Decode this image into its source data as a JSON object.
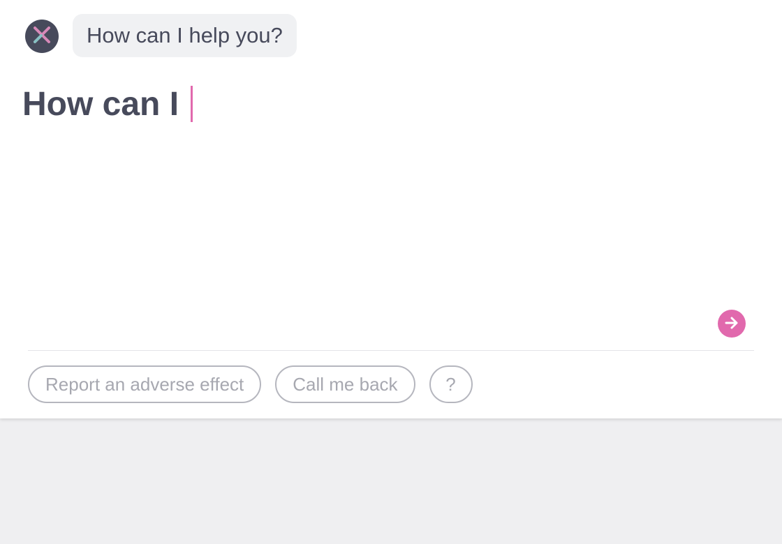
{
  "bot": {
    "avatar_icon": "logo-x-icon",
    "greeting": "How can I help you?"
  },
  "composer": {
    "typed_text": "How can I ",
    "send_icon": "arrow-right-icon"
  },
  "quick_replies": [
    {
      "label": "Report an adverse effect"
    },
    {
      "label": "Call me back"
    },
    {
      "label": "?"
    }
  ],
  "colors": {
    "accent": "#e169ad",
    "text": "#474a5b",
    "chip_border": "#b5b6be",
    "chip_text": "#a7a8b0",
    "background": "#efeff1"
  }
}
